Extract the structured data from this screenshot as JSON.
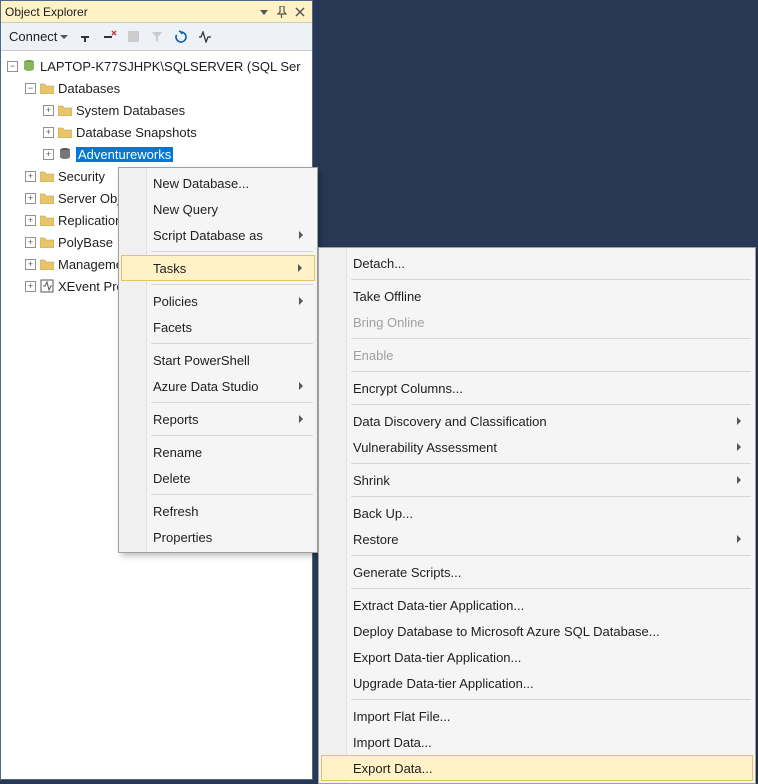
{
  "header": {
    "title": "Object Explorer"
  },
  "toolbar": {
    "connect": "Connect"
  },
  "tree": {
    "server": "LAPTOP-K77SJHPK\\SQLSERVER (SQL Ser",
    "databases": "Databases",
    "sysdb": "System Databases",
    "snapshots": "Database Snapshots",
    "adventureworks": "Adventureworks",
    "security": "Security",
    "serverobj": "Server Objects",
    "replication": "Replication",
    "polybase": "PolyBase",
    "management": "Management",
    "xevent": "XEvent Profiler"
  },
  "menu1": {
    "items": [
      {
        "label": "New Database...",
        "type": "item"
      },
      {
        "label": "New Query",
        "type": "item"
      },
      {
        "label": "Script Database as",
        "type": "sub"
      },
      {
        "type": "sep"
      },
      {
        "label": "Tasks",
        "type": "sub",
        "hl": true
      },
      {
        "type": "sep"
      },
      {
        "label": "Policies",
        "type": "sub"
      },
      {
        "label": "Facets",
        "type": "item"
      },
      {
        "type": "sep"
      },
      {
        "label": "Start PowerShell",
        "type": "item"
      },
      {
        "label": "Azure Data Studio",
        "type": "sub"
      },
      {
        "type": "sep"
      },
      {
        "label": "Reports",
        "type": "sub"
      },
      {
        "type": "sep"
      },
      {
        "label": "Rename",
        "type": "item"
      },
      {
        "label": "Delete",
        "type": "item"
      },
      {
        "type": "sep"
      },
      {
        "label": "Refresh",
        "type": "item"
      },
      {
        "label": "Properties",
        "type": "item"
      }
    ]
  },
  "menu2": {
    "items": [
      {
        "label": "Detach...",
        "type": "item"
      },
      {
        "type": "sep"
      },
      {
        "label": "Take Offline",
        "type": "item"
      },
      {
        "label": "Bring Online",
        "type": "item",
        "disabled": true
      },
      {
        "type": "sep"
      },
      {
        "label": "Enable",
        "type": "item",
        "disabled": true
      },
      {
        "type": "sep"
      },
      {
        "label": "Encrypt Columns...",
        "type": "item"
      },
      {
        "type": "sep"
      },
      {
        "label": "Data Discovery and Classification",
        "type": "sub"
      },
      {
        "label": "Vulnerability Assessment",
        "type": "sub"
      },
      {
        "type": "sep"
      },
      {
        "label": "Shrink",
        "type": "sub"
      },
      {
        "type": "sep"
      },
      {
        "label": "Back Up...",
        "type": "item"
      },
      {
        "label": "Restore",
        "type": "sub"
      },
      {
        "type": "sep"
      },
      {
        "label": "Generate Scripts...",
        "type": "item"
      },
      {
        "type": "sep"
      },
      {
        "label": "Extract Data-tier Application...",
        "type": "item"
      },
      {
        "label": "Deploy Database to Microsoft Azure SQL Database...",
        "type": "item"
      },
      {
        "label": "Export Data-tier Application...",
        "type": "item"
      },
      {
        "label": "Upgrade Data-tier Application...",
        "type": "item"
      },
      {
        "type": "sep"
      },
      {
        "label": "Import Flat File...",
        "type": "item"
      },
      {
        "label": "Import Data...",
        "type": "item"
      },
      {
        "label": "Export Data...",
        "type": "item",
        "hl": true
      }
    ]
  }
}
